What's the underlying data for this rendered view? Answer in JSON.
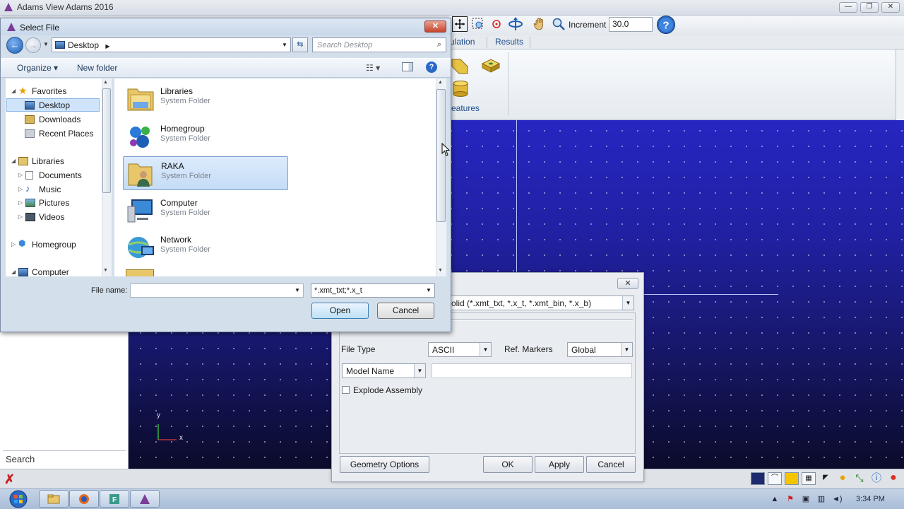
{
  "app": {
    "title": "Adams View Adams 2016",
    "increment_label": "Increment",
    "increment_value": "30.0",
    "tabs": [
      "ulation",
      "Results"
    ],
    "features_label": "eatures",
    "search_label": "Search"
  },
  "viewport": {
    "axis_y": "y",
    "axis_x": "x"
  },
  "import_dialog": {
    "file_filter": "olid (*.xmt_txt, *.x_t, *.xmt_bin, *.x_b)",
    "file_type_label": "File Type",
    "file_type_value": "ASCII",
    "ref_markers_label": "Ref. Markers",
    "ref_markers_value": "Global",
    "model_name_select": "Model Name",
    "explode_label": "Explode Assembly",
    "geometry_options": "Geometry Options",
    "ok": "OK",
    "apply": "Apply",
    "cancel": "Cancel"
  },
  "select_file": {
    "title": "Select File",
    "address": "Desktop",
    "search_placeholder": "Search Desktop",
    "organize": "Organize ▾",
    "new_folder": "New folder",
    "nav": {
      "favorites": "Favorites",
      "desktop": "Desktop",
      "downloads": "Downloads",
      "recent_places": "Recent Places",
      "libraries": "Libraries",
      "documents": "Documents",
      "music": "Music",
      "pictures": "Pictures",
      "videos": "Videos",
      "homegroup": "Homegroup",
      "computer": "Computer"
    },
    "files": [
      {
        "name": "Libraries",
        "type": "System Folder"
      },
      {
        "name": "Homegroup",
        "type": "System Folder"
      },
      {
        "name": "RAKA",
        "type": "System Folder"
      },
      {
        "name": "Computer",
        "type": "System Folder"
      },
      {
        "name": "Network",
        "type": "System Folder"
      }
    ],
    "file_name_label": "File name:",
    "file_type_filter": "*.xmt_txt;*.x_t",
    "open": "Open",
    "cancel": "Cancel"
  },
  "taskbar": {
    "clock": "3:34 PM"
  }
}
